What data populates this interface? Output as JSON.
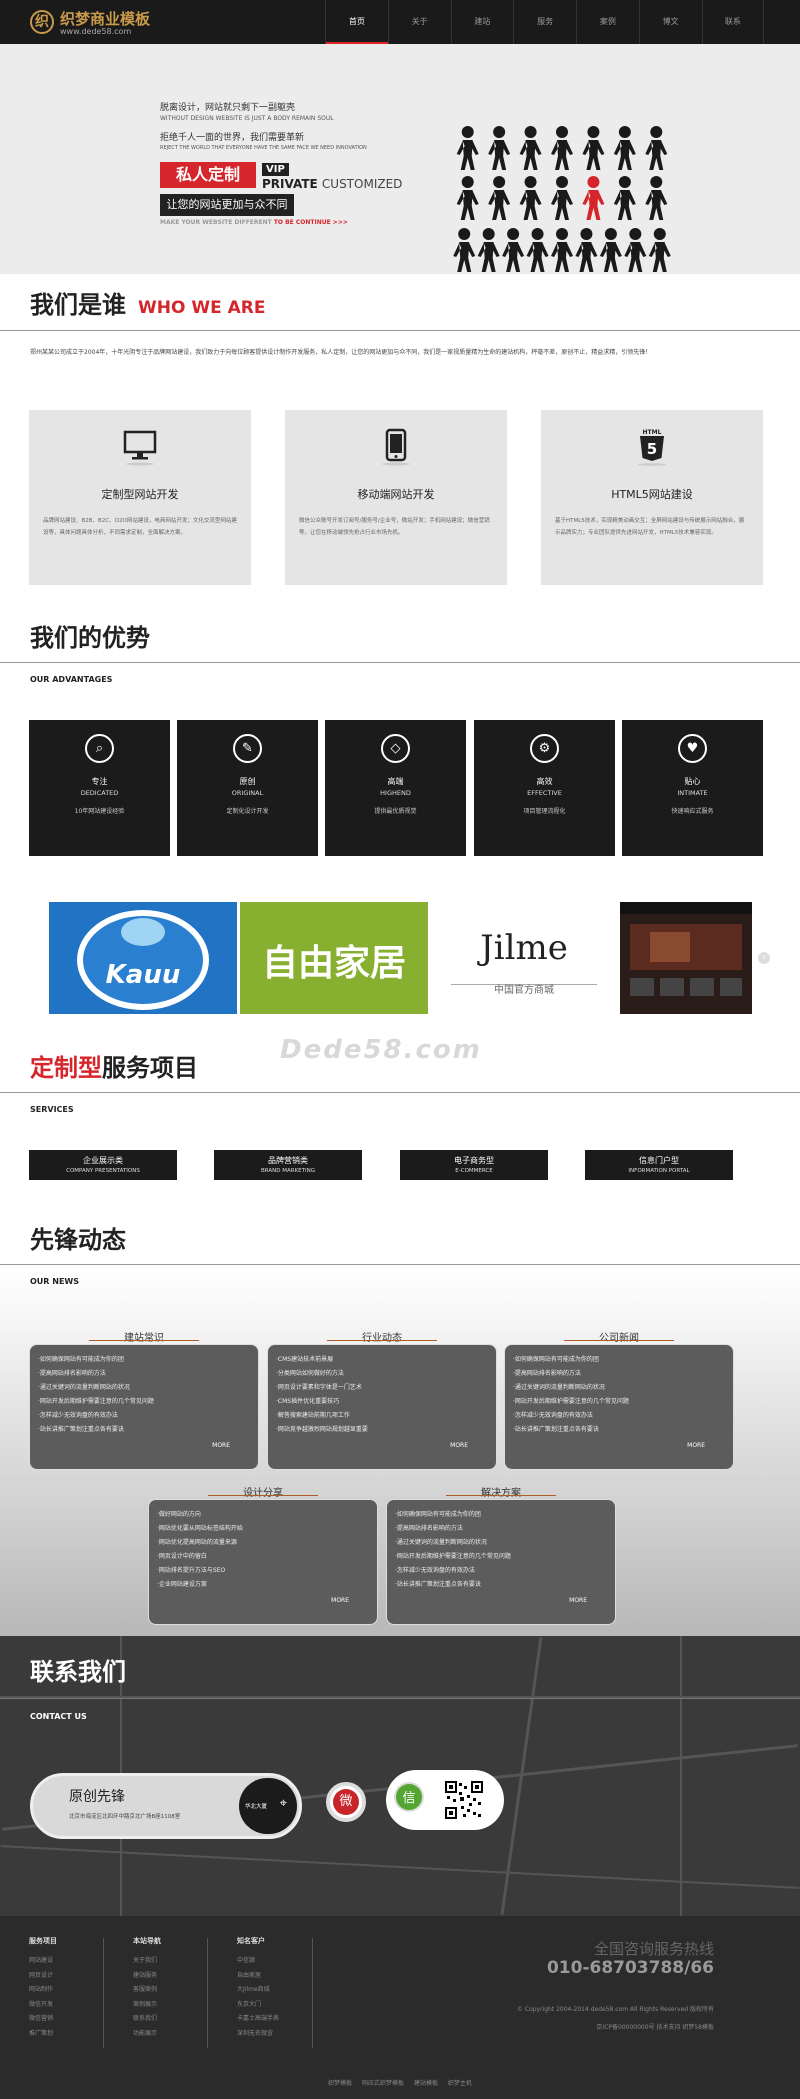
{
  "header": {
    "logo_mark": "织",
    "logo_title": "织梦商业模板",
    "logo_url": "www.dede58.com",
    "nav": [
      "首页",
      "关于",
      "建站",
      "服务",
      "案例",
      "博文",
      "联系"
    ]
  },
  "banner": {
    "line1": "脱离设计，网站就只剩下一副躯壳",
    "line2": "WITHOUT DESIGN WEBSITE IS JUST A BODY REMAIN SOUL",
    "line3": "拒绝千人一面的世界，我们需要革新",
    "line4": "REJECT THE WORLD THAT EVERYONE HAVE THE SAME FACE WE NEED INNOVATION",
    "red_tag": "私人定制",
    "vip": "VIP",
    "private": "PRIVATE",
    "customized": "CUSTOMIZED",
    "dark_tag": "让您的网站更加与众不同",
    "make": "MAKE YOUR WEBSITE DIFFERENT",
    "make_red": "TO BE CONTINUE >>>"
  },
  "about": {
    "title": "我们是谁",
    "title_en": "WHO WE ARE",
    "intro": "郑州某某公司成立于2004年，十年光阴专注于品牌网站建设，我们致力于向每位顾客提供设计制作开发服务，私人定制，让您的网站更加与众不同，我们是一家视质量精为生命的建站机构，秤毫不差，原创不止，精益求精，引领先锋！",
    "services": [
      {
        "icon": "monitor-icon",
        "title": "定制型网站开发",
        "desc": "品牌网站建设、B2B、B2C、O2O网站建设，电商网站开发；文化交流型网站建设等，具体问题具体分析，不同需求定制，全面解决方案。"
      },
      {
        "icon": "mobile-icon",
        "title": "移动端网站开发",
        "desc": "微信公众账号开发订阅号/服务号/企业号，微站开发；手机网站建设；微信营销等，让您在移动端领先抢占行业市场先机。"
      },
      {
        "icon": "html5-icon",
        "title": "HTML5网站建设",
        "desc": "基于HTML5技术，实现精美动画交互；全屏网站建设与传统展示网站融合，展示品牌实力；专业团队提供先进网站开发，HTML5技术兼容实现。"
      }
    ]
  },
  "advantages": {
    "title": "我们的优势",
    "sub": "OUR ADVANTAGES",
    "items": [
      {
        "icon": "search-icon",
        "cn": "专注",
        "en": "DEDICATED",
        "desc": "10年网站建设经验"
      },
      {
        "icon": "pen-icon",
        "cn": "原创",
        "en": "ORIGINAL",
        "desc": "定制化设计开发"
      },
      {
        "icon": "diamond-icon",
        "cn": "高端",
        "en": "HIGHEND",
        "desc": "提供最优质视觉"
      },
      {
        "icon": "gear-icon",
        "cn": "高效",
        "en": "EFFECTIVE",
        "desc": "项目管理流程化"
      },
      {
        "icon": "heart-icon",
        "cn": "贴心",
        "en": "INTIMATE",
        "desc": "快速响应式服务"
      }
    ]
  },
  "partners": {
    "kauu": "Kauu",
    "ziyou": "自由家居",
    "jilme": "Jilme",
    "jilme_sub": "中国官方商城",
    "watermark": "Dede58.com",
    "arrow": "›"
  },
  "services": {
    "title_red": "定制型",
    "title": "服务项目",
    "sub": "SERVICES",
    "items": [
      {
        "cn": "企业展示类",
        "en": "COMPANY PRESENTATIONS"
      },
      {
        "cn": "品牌营销类",
        "en": "BRAND MARKETING"
      },
      {
        "cn": "电子商务型",
        "en": "E-COMMERCE"
      },
      {
        "cn": "信息门户型",
        "en": "INFORMATION PORTAL"
      }
    ]
  },
  "news": {
    "title": "先锋动态",
    "sub": "OUR NEWS",
    "more": "MORE",
    "boxes": [
      {
        "title": "建站常识",
        "items": [
          "·如何确保网站有可能成为你的团",
          "·提高网站排名影响的方法",
          "·通过关键词的流量判断网站的状况",
          "·网站开发后期维护需要注意的几个常见问题",
          "·怎样减少无效询盘的有效办法",
          "·站长讲推广策划注重点各有要诀"
        ]
      },
      {
        "title": "行业动态",
        "items": [
          "·CMS建站技术前景展",
          "·分类网站如何做好的方法",
          "·网页设计要素和字体是一门艺术",
          "·CMS插件优化重要技巧",
          "·解答搜索建站前期几项工作",
          "·网站竞争越激烈网站规划越显重要"
        ]
      },
      {
        "title": "公司新闻",
        "items": [
          "·如何确保网站有可能成为你的团",
          "·提高网站排名影响的方法",
          "·通过关键词的流量判断网站的状况",
          "·网站开发后期维护需要注意的几个常见问题",
          "·怎样减少无效询盘的有效办法",
          "·站长讲推广策划注重点各有要诀"
        ]
      },
      {
        "title": "设计分享",
        "items": [
          "·做好网站的方向",
          "·网站优化要从网站标签结构开始",
          "·网站优化提高网站的流量来源",
          "·网页设计中的留白",
          "·网站排名提升方法与SEO",
          "·企业网站建设方案"
        ]
      },
      {
        "title": "解决方案",
        "items": [
          "·如何确保网站有可能成为你的团",
          "·提高网站排名影响的方法",
          "·通过关键词的流量判断网站的状况",
          "·网站开发后期维护需要注意的几个常见问题",
          "·怎样减少无效询盘的有效办法",
          "·站长讲推广策划注重点各有要诀"
        ]
      }
    ]
  },
  "contact": {
    "title": "联系我们",
    "sub": "CONTACT US",
    "name": "原创先锋",
    "address": "北京市海淀区北四环中路京北广场B座1108室",
    "building": "华北大厦",
    "weibo_glyph": "微",
    "wechat_glyph": "信"
  },
  "footer": {
    "cols": [
      {
        "title": "服务项目",
        "items": [
          "网站建设",
          "网页设计",
          "网站制作",
          "微信开发",
          "微信营销",
          "推广策划"
        ]
      },
      {
        "title": "本站导航",
        "items": [
          "关于我们",
          "建站服务",
          "客服案例",
          "案例展示",
          "联系我们",
          "功能展示"
        ]
      },
      {
        "title": "知名客户",
        "items": [
          "中信银",
          "自由家居",
          "大Jilme商城",
          "东京大门",
          "卡嘉士高端手表",
          "深圳无名微宣"
        ]
      }
    ],
    "hotline_title": "全国咨询服务热线",
    "hotline": "010-68703788/66",
    "copyright": "© Copyright 2004-2014 dede58.com All Rights Reserved 版权所有",
    "icp": "京ICP备00000000号   技术支持   织梦58模板",
    "links": [
      "织梦模板",
      "响应式织梦模板",
      "建站模板",
      "织梦主机"
    ]
  }
}
